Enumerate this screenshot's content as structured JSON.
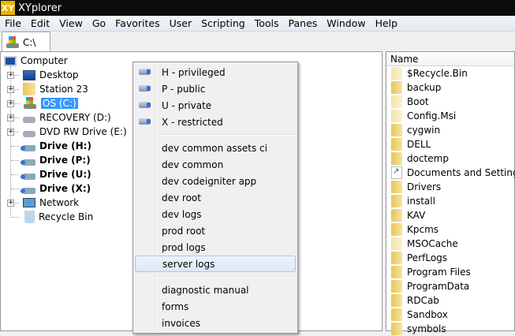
{
  "window": {
    "title": "XYplorer",
    "logo": "XY"
  },
  "menubar": [
    "File",
    "Edit",
    "View",
    "Go",
    "Favorites",
    "User",
    "Scripting",
    "Tools",
    "Panes",
    "Window",
    "Help"
  ],
  "tab": {
    "label": "C:\\"
  },
  "tree": [
    {
      "label": "Computer",
      "icon": "computer",
      "level": 0
    },
    {
      "label": "Desktop",
      "icon": "desktop",
      "level": 1,
      "expand": true
    },
    {
      "label": "Station 23",
      "icon": "folder",
      "level": 1,
      "expand": true
    },
    {
      "label": "OS (C:)",
      "icon": "system-drive",
      "level": 1,
      "expand": true,
      "selected": true
    },
    {
      "label": "RECOVERY (D:)",
      "icon": "disk",
      "level": 1,
      "expand": true
    },
    {
      "label": "DVD RW Drive (E:)",
      "icon": "dvd-drive",
      "level": 1,
      "expand": true
    },
    {
      "label": "Drive (H:)",
      "icon": "network-drive",
      "level": 1,
      "bold": true
    },
    {
      "label": "Drive (P:)",
      "icon": "network-drive",
      "level": 1,
      "bold": true
    },
    {
      "label": "Drive (U:)",
      "icon": "network-drive",
      "level": 1,
      "bold": true
    },
    {
      "label": "Drive (X:)",
      "icon": "network-drive",
      "level": 1,
      "bold": true
    },
    {
      "label": "Network",
      "icon": "network",
      "level": 1,
      "expand": true
    },
    {
      "label": "Recycle Bin",
      "icon": "recycle-bin",
      "level": 1
    }
  ],
  "context_menu": {
    "groups": [
      [
        {
          "label": "H - privileged",
          "icon": "network-drive"
        },
        {
          "label": "P - public",
          "icon": "network-drive"
        },
        {
          "label": "U - private",
          "icon": "network-drive"
        },
        {
          "label": "X - restricted",
          "icon": "network-drive"
        }
      ],
      [
        {
          "label": "dev common assets ci"
        },
        {
          "label": "dev common"
        },
        {
          "label": "dev codeigniter app"
        },
        {
          "label": "dev root"
        },
        {
          "label": "dev logs"
        },
        {
          "label": "prod root"
        },
        {
          "label": "prod logs"
        },
        {
          "label": "server logs",
          "highlighted": true
        }
      ],
      [
        {
          "label": "diagnostic manual"
        },
        {
          "label": "forms"
        },
        {
          "label": "invoices"
        }
      ]
    ]
  },
  "filelist": {
    "column": "Name",
    "items": [
      {
        "name": "$Recycle.Bin",
        "icon": "folder-hidden"
      },
      {
        "name": "backup",
        "icon": "folder"
      },
      {
        "name": "Boot",
        "icon": "folder-hidden"
      },
      {
        "name": "Config.Msi",
        "icon": "folder-hidden"
      },
      {
        "name": "cygwin",
        "icon": "folder"
      },
      {
        "name": "DELL",
        "icon": "folder"
      },
      {
        "name": "doctemp",
        "icon": "folder"
      },
      {
        "name": "Documents and Settings",
        "icon": "shortcut"
      },
      {
        "name": "Drivers",
        "icon": "folder"
      },
      {
        "name": "install",
        "icon": "folder"
      },
      {
        "name": "KAV",
        "icon": "folder"
      },
      {
        "name": "Kpcms",
        "icon": "folder"
      },
      {
        "name": "MSOCache",
        "icon": "folder-hidden"
      },
      {
        "name": "PerfLogs",
        "icon": "folder"
      },
      {
        "name": "Program Files",
        "icon": "folder"
      },
      {
        "name": "ProgramData",
        "icon": "folder"
      },
      {
        "name": "RDCab",
        "icon": "folder"
      },
      {
        "name": "Sandbox",
        "icon": "folder"
      },
      {
        "name": "symbols",
        "icon": "folder"
      }
    ]
  }
}
